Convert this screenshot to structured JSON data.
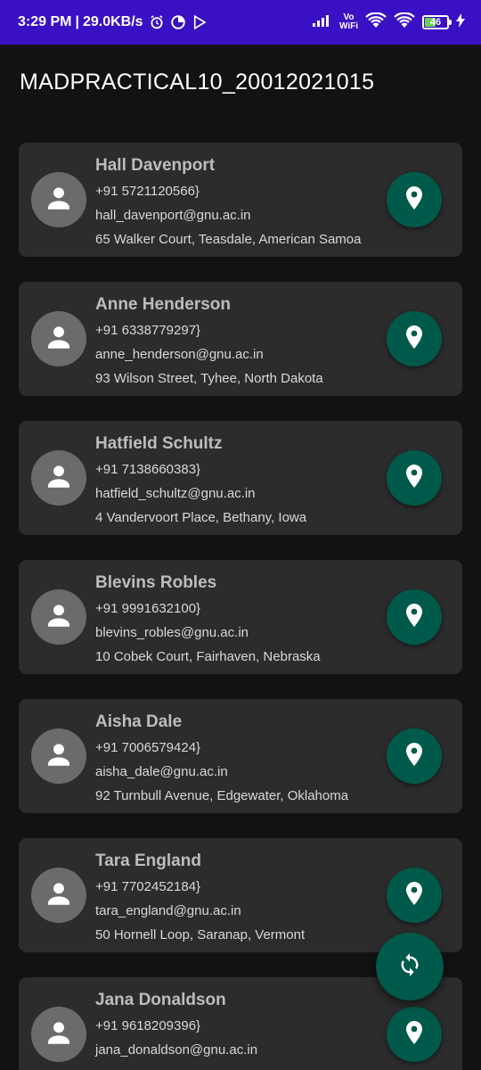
{
  "status_bar": {
    "time": "3:29 PM",
    "separator": "|",
    "network_speed": "29.0KB/s",
    "vowifi_top": "Vo",
    "vowifi_bottom": "WiFi",
    "battery_level": "46",
    "battery_fraction": 0.46,
    "icons": [
      "alarm-icon",
      "data-saver-icon",
      "play-icon",
      "signal-icon",
      "wifi-icon",
      "hotspot-icon",
      "battery-icon",
      "charging-icon"
    ]
  },
  "app_bar": {
    "title": "MADPRACTICAL10_20012021015"
  },
  "contacts": [
    {
      "name": "Hall Davenport",
      "phone": "+91 5721120566}",
      "email": "hall_davenport@gnu.ac.in",
      "address": "65 Walker Court, Teasdale, American Samoa"
    },
    {
      "name": "Anne Henderson",
      "phone": "+91 6338779297}",
      "email": "anne_henderson@gnu.ac.in",
      "address": "93 Wilson Street, Tyhee, North Dakota"
    },
    {
      "name": "Hatfield Schultz",
      "phone": "+91 7138660383}",
      "email": "hatfield_schultz@gnu.ac.in",
      "address": "4 Vandervoort Place, Bethany, Iowa"
    },
    {
      "name": "Blevins Robles",
      "phone": "+91 9991632100}",
      "email": "blevins_robles@gnu.ac.in",
      "address": "10 Cobek Court, Fairhaven, Nebraska"
    },
    {
      "name": "Aisha Dale",
      "phone": "+91 7006579424}",
      "email": "aisha_dale@gnu.ac.in",
      "address": "92 Turnbull Avenue, Edgewater, Oklahoma"
    },
    {
      "name": "Tara England",
      "phone": "+91 7702452184}",
      "email": "tara_england@gnu.ac.in",
      "address": "50 Hornell Loop, Saranap, Vermont"
    },
    {
      "name": "Jana Donaldson",
      "phone": "+91 9618209396}",
      "email": "jana_donaldson@gnu.ac.in",
      "address": ""
    }
  ],
  "icons": {
    "avatar": "person-icon",
    "map_button": "location-pin-icon",
    "fab": "refresh-icon"
  },
  "colors": {
    "status_bar": "#3a10c4",
    "background": "#121212",
    "card": "#2c2c2c",
    "accent": "#005a4c",
    "avatar": "#6b6b6b"
  }
}
